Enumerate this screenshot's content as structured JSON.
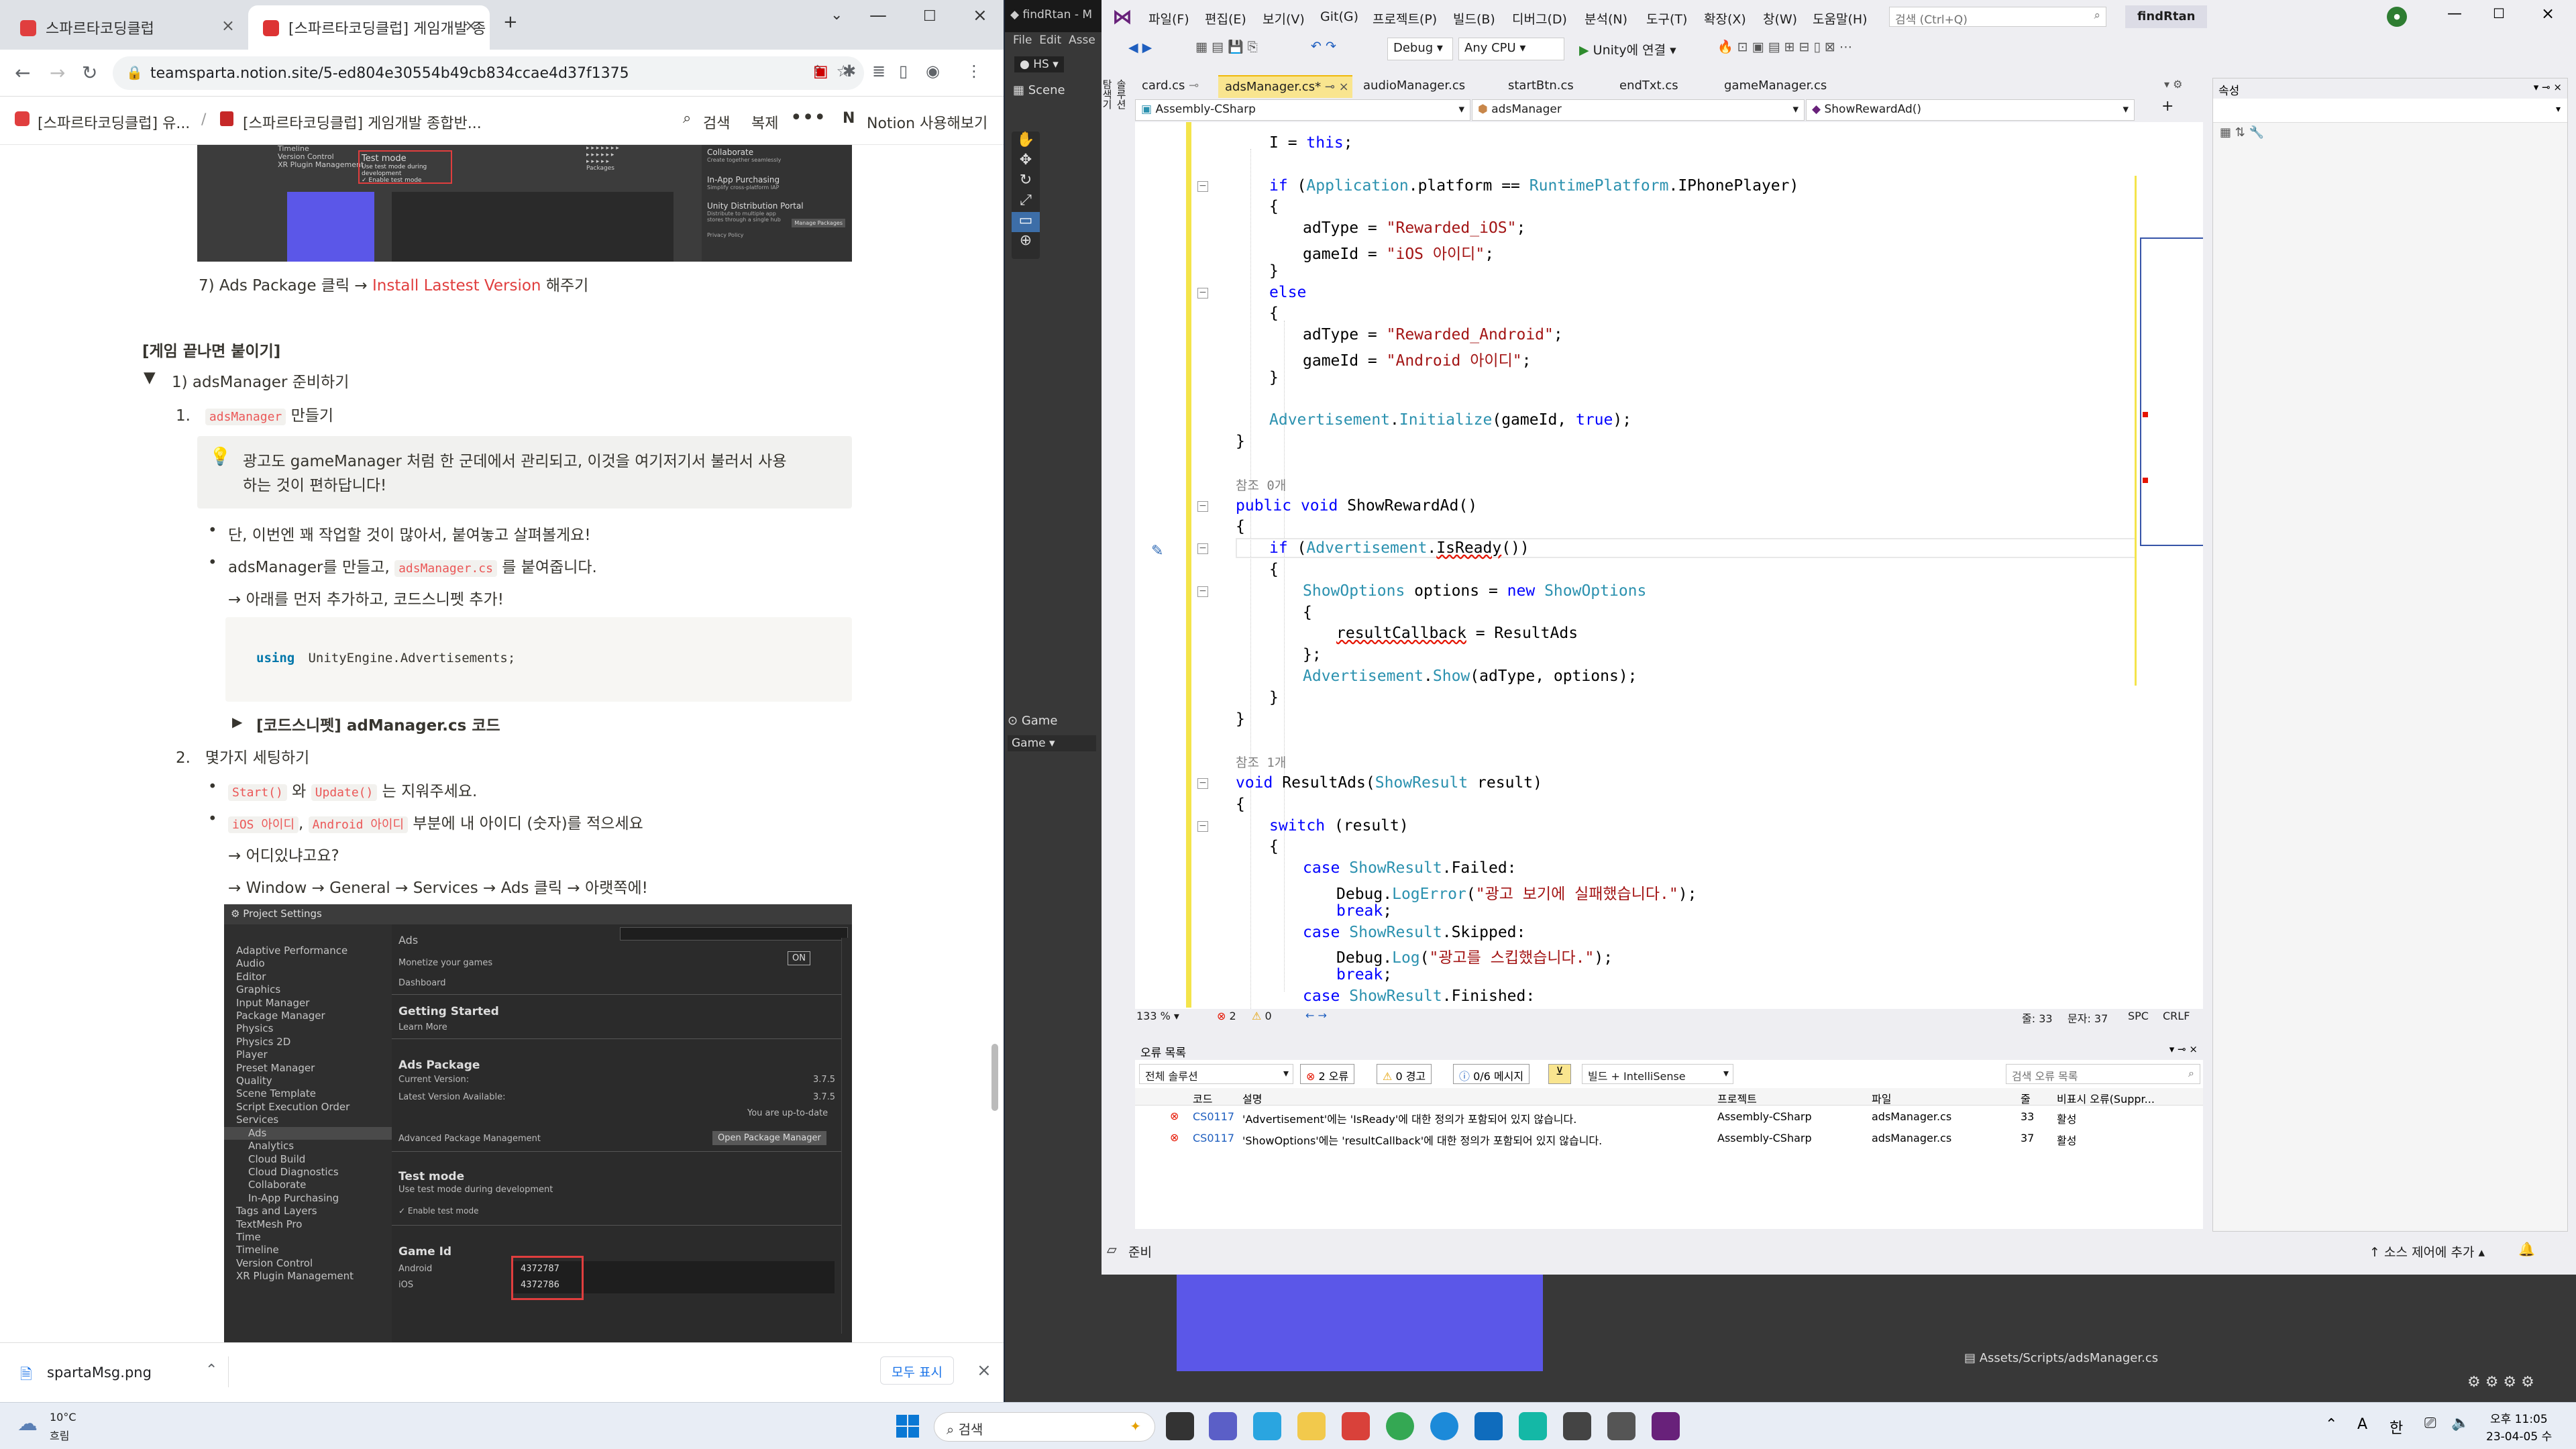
{
  "chrome": {
    "tabs": [
      {
        "title": "스파르타코딩클럽"
      },
      {
        "title": "[스파르타코딩클럽] 게임개발 종"
      }
    ],
    "url": "teamsparta.notion.site/5-ed804e30554b49cb834ccae4d37f1375",
    "breadcrumb1": "[스파르타코딩클럽] 유...",
    "breadcrumb2": "[스파르타코딩클럽] 게임개발 종합반...",
    "search_label": "검색",
    "duplicate_label": "복제",
    "use_notion_label": "Notion 사용해보기"
  },
  "notion": {
    "step7": [
      "7) Ads Package 클릭 → ",
      "Install Lastest Version",
      " 해주기"
    ],
    "section_heading": "[게임 끝나면 붙이기]",
    "toggle1": "1) adsManager 준비하기",
    "item1_code": "adsManager",
    "item1_text": " 만들기",
    "callout": [
      "광고도 gameManager 처럼 한 군데에서 관리되고, 이것을 여기저기서 불러서 사용",
      "하는 것이 편하답니다!"
    ],
    "bullet1": "단, 이번엔 꽤 작업할 것이 많아서, 붙여놓고 살펴볼게요!",
    "bullet2_a": "adsManager를 만들고, ",
    "bullet2_code": "adsManager.cs",
    "bullet2_b": " 를 붙여줍니다.",
    "bullet2_sub": "→ 아래를 먼저 추가하고, 코드스니펫 추가!",
    "code_using": "using",
    "code_ns": " UnityEngine.Advertisements;",
    "toggle2": "[코드스니펫] adManager.cs 코드",
    "item2": "몇가지 세팅하기",
    "b3_code1": "Start()",
    "b3_mid": " 와 ",
    "b3_code2": "Update()",
    "b3_end": " 는 지워주세요.",
    "b4_code1": "iOS 아이디",
    "b4_sep": ", ",
    "b4_code2": "Android 아이디",
    "b4_end": " 부분에 내 아이디 (숫자)를 적으세요",
    "b4_sub1": "→ 어디있냐고요?",
    "b4_sub2": "→ Window → General → Services → Ads 클릭 → 아랫쪽에!"
  },
  "top_screenshot": {
    "labels": [
      "Timeline",
      "Version Control",
      "XR Plugin Management"
    ],
    "test_mode": "Test mode",
    "test_mode_sub": "Use test mode during development",
    "enable": "✓ Enable test mode",
    "collab": "Collaborate",
    "collab_sub": "Create together seamlessly",
    "iap": "In-App Purchasing",
    "iap_sub": "Simplify cross-platform IAP",
    "udp": "Unity Distribution Portal",
    "udp_sub": "Distribute to multiple app stores through a single hub",
    "privacy": "Privacy Policy",
    "packages": "Packages",
    "manage": "Manage Packages"
  },
  "settings_screenshot": {
    "title": "Project Settings",
    "sidebar": [
      "Adaptive Performance",
      "Audio",
      "Editor",
      "Graphics",
      "Input Manager",
      "Package Manager",
      "Physics",
      "Physics 2D",
      "Player",
      "Preset Manager",
      "Quality",
      "Scene Template",
      "Script Execution Order",
      "Services",
      "Ads",
      "Analytics",
      "Cloud Build",
      "Cloud Diagnostics",
      "Collaborate",
      "In-App Purchasing",
      "Tags and Layers",
      "TextMesh Pro",
      "Time",
      "Timeline",
      "Version Control",
      "XR Plugin Management"
    ],
    "ads_header": "Ads",
    "monetize": "Monetize your games",
    "dashboard": "Dashboard",
    "on": "ON",
    "getting_started": "Getting Started",
    "learn_more": "Learn More",
    "ads_package": "Ads Package",
    "current_version_label": "Current Version:",
    "current_version": "3.7.5",
    "latest_label": "Latest Version Available:",
    "latest": "3.7.5",
    "up_to_date": "You are up-to-date",
    "advanced": "Advanced Package Management",
    "open_pm": "Open Package Manager",
    "test_mode": "Test mode",
    "test_mode_sub": "Use test mode during development",
    "enable": "✓ Enable test mode",
    "game_id": "Game Id",
    "android_label": "Android",
    "android_id": "4372787",
    "ios_label": "iOS",
    "ios_id": "4372786"
  },
  "downloads": {
    "file": "spartaMsg.png",
    "show_all": "모두 표시"
  },
  "unity": {
    "title": "findRtan - M",
    "menu": [
      "File",
      "Edit",
      "Asse"
    ],
    "account": "HS",
    "scene": "Scene",
    "game_tab": "Game",
    "game_dd": "Game",
    "asset_path": "Assets/Scripts/adsManager.cs"
  },
  "vs": {
    "menu": [
      "파일(F)",
      "편집(E)",
      "보기(V)",
      "Git(G)",
      "프로젝트(P)",
      "빌드(B)",
      "디버그(D)",
      "분석(N)",
      "도구(T)",
      "확장(X)",
      "창(W)",
      "도움말(H)"
    ],
    "search_placeholder": "검색 (Ctrl+Q)",
    "solution_name": "findRtan",
    "config": "Debug",
    "platform": "Any CPU",
    "run_label": "Unity에 연결",
    "doc_tabs": [
      "card.cs",
      "adsManager.cs*",
      "audioManager.cs",
      "startBtn.cs",
      "endTxt.cs",
      "gameManager.cs"
    ],
    "nav_project": "Assembly-CSharp",
    "nav_class": "adsManager",
    "nav_member": "ShowRewardAd()",
    "side_label": "솔루션 탐색기",
    "zoom": "133 %",
    "errors_count": "2",
    "warnings_count": "0",
    "cursor_line": "줄: 33",
    "cursor_col": "문자: 37",
    "spc": "SPC",
    "crlf": "CRLF",
    "properties_title": "속성",
    "status": "준비",
    "source_control": "소스 제어에 추가"
  },
  "code_lines": [
    {
      "indent": 1,
      "tokens": [
        [
          "",
          "I = "
        ],
        [
          "kw",
          "this"
        ],
        [
          "",
          ";"
        ]
      ]
    },
    {
      "indent": 0,
      "tokens": []
    },
    {
      "indent": 1,
      "tokens": [
        [
          "kw",
          "if"
        ],
        [
          "",
          " ("
        ],
        [
          "ty",
          "Application"
        ],
        [
          "",
          ".platform == "
        ],
        [
          "ty",
          "RuntimePlatform"
        ],
        [
          "",
          ".IPhonePlayer)"
        ]
      ],
      "fold": true
    },
    {
      "indent": 1,
      "tokens": [
        [
          "",
          "{"
        ]
      ]
    },
    {
      "indent": 2,
      "tokens": [
        [
          "",
          "adType = "
        ],
        [
          "st",
          "\"Rewarded_iOS\""
        ],
        [
          "",
          ";"
        ]
      ]
    },
    {
      "indent": 2,
      "tokens": [
        [
          "",
          "gameId = "
        ],
        [
          "st",
          "\"iOS 아이디\""
        ],
        [
          "",
          ";"
        ]
      ]
    },
    {
      "indent": 1,
      "tokens": [
        [
          "",
          "}"
        ]
      ]
    },
    {
      "indent": 1,
      "tokens": [
        [
          "kw",
          "else"
        ]
      ],
      "fold": true
    },
    {
      "indent": 1,
      "tokens": [
        [
          "",
          "{"
        ]
      ]
    },
    {
      "indent": 2,
      "tokens": [
        [
          "",
          "adType = "
        ],
        [
          "st",
          "\"Rewarded_Android\""
        ],
        [
          "",
          ";"
        ]
      ]
    },
    {
      "indent": 2,
      "tokens": [
        [
          "",
          "gameId = "
        ],
        [
          "st",
          "\"Android 아이디\""
        ],
        [
          "",
          ";"
        ]
      ]
    },
    {
      "indent": 1,
      "tokens": [
        [
          "",
          "}"
        ]
      ]
    },
    {
      "indent": 0,
      "tokens": []
    },
    {
      "indent": 1,
      "tokens": [
        [
          "ty",
          "Advertisement"
        ],
        [
          "",
          "."
        ],
        [
          "ty",
          "Initialize"
        ],
        [
          "",
          "(gameId, "
        ],
        [
          "kw",
          "true"
        ],
        [
          "",
          ");"
        ]
      ]
    },
    {
      "indent": 0,
      "tokens": [
        [
          "",
          "}"
        ]
      ]
    },
    {
      "indent": 0,
      "tokens": []
    },
    {
      "indent": 0,
      "tokens": [
        [
          "cm",
          "참조 0개"
        ]
      ]
    },
    {
      "indent": 0,
      "tokens": [
        [
          "kw",
          "public"
        ],
        [
          "",
          " "
        ],
        [
          "kw",
          "void"
        ],
        [
          "",
          " ShowRewardAd()"
        ]
      ],
      "fold": true
    },
    {
      "indent": 0,
      "tokens": [
        [
          "",
          "{"
        ]
      ]
    },
    {
      "indent": 1,
      "tokens": [
        [
          "kw",
          "if"
        ],
        [
          "",
          " ("
        ],
        [
          "ty",
          "Advertisement"
        ],
        [
          "",
          "."
        ],
        [
          "err",
          "IsReady"
        ],
        [
          "",
          "())"
        ]
      ],
      "fold": true,
      "current": true
    },
    {
      "indent": 1,
      "tokens": [
        [
          "",
          "{"
        ]
      ]
    },
    {
      "indent": 2,
      "tokens": [
        [
          "ty",
          "ShowOptions"
        ],
        [
          "",
          " options = "
        ],
        [
          "kw",
          "new"
        ],
        [
          "",
          " "
        ],
        [
          "ty",
          "ShowOptions"
        ]
      ],
      "fold": true
    },
    {
      "indent": 2,
      "tokens": [
        [
          "",
          "{"
        ]
      ]
    },
    {
      "indent": 3,
      "tokens": [
        [
          "err",
          "resultCallback"
        ],
        [
          "",
          " = ResultAds"
        ]
      ]
    },
    {
      "indent": 2,
      "tokens": [
        [
          "",
          "};"
        ]
      ]
    },
    {
      "indent": 2,
      "tokens": [
        [
          "ty",
          "Advertisement"
        ],
        [
          "",
          "."
        ],
        [
          "ty",
          "Show"
        ],
        [
          "",
          "(adType, options);"
        ]
      ]
    },
    {
      "indent": 1,
      "tokens": [
        [
          "",
          "}"
        ]
      ]
    },
    {
      "indent": 0,
      "tokens": [
        [
          "",
          "}"
        ]
      ]
    },
    {
      "indent": 0,
      "tokens": []
    },
    {
      "indent": 0,
      "tokens": [
        [
          "cm",
          "참조 1개"
        ]
      ]
    },
    {
      "indent": 0,
      "tokens": [
        [
          "kw",
          "void"
        ],
        [
          "",
          " ResultAds("
        ],
        [
          "ty",
          "ShowResult"
        ],
        [
          "",
          " result)"
        ]
      ],
      "fold": true
    },
    {
      "indent": 0,
      "tokens": [
        [
          "",
          "{"
        ]
      ]
    },
    {
      "indent": 1,
      "tokens": [
        [
          "kw",
          "switch"
        ],
        [
          "",
          " (result)"
        ]
      ],
      "fold": true
    },
    {
      "indent": 1,
      "tokens": [
        [
          "",
          "{"
        ]
      ]
    },
    {
      "indent": 2,
      "tokens": [
        [
          "kw",
          "case"
        ],
        [
          "",
          " "
        ],
        [
          "ty",
          "ShowResult"
        ],
        [
          "",
          ".Failed:"
        ]
      ]
    },
    {
      "indent": 3,
      "tokens": [
        [
          "",
          "Debug."
        ],
        [
          "ty",
          "LogError"
        ],
        [
          "",
          "("
        ],
        [
          "st",
          "\"광고 보기에 실패했습니다.\""
        ],
        [
          "",
          ");"
        ]
      ]
    },
    {
      "indent": 3,
      "tokens": [
        [
          "kw",
          "break"
        ],
        [
          "",
          ";"
        ]
      ]
    },
    {
      "indent": 2,
      "tokens": [
        [
          "kw",
          "case"
        ],
        [
          "",
          " "
        ],
        [
          "ty",
          "ShowResult"
        ],
        [
          "",
          ".Skipped:"
        ]
      ]
    },
    {
      "indent": 3,
      "tokens": [
        [
          "",
          "Debug."
        ],
        [
          "ty",
          "Log"
        ],
        [
          "",
          "("
        ],
        [
          "st",
          "\"광고를 스킵했습니다.\""
        ],
        [
          "",
          ");"
        ]
      ]
    },
    {
      "indent": 3,
      "tokens": [
        [
          "kw",
          "break"
        ],
        [
          "",
          ";"
        ]
      ]
    },
    {
      "indent": 2,
      "tokens": [
        [
          "kw",
          "case"
        ],
        [
          "",
          " "
        ],
        [
          "ty",
          "ShowResult"
        ],
        [
          "",
          ".Finished:"
        ]
      ]
    }
  ],
  "error_list": {
    "title": "오류 목록",
    "scope": "전체 솔루션",
    "errors_btn": "2 오류",
    "warnings_btn": "0 경고",
    "messages_btn": "0/6 메시지",
    "build_filter": "빌드 + IntelliSense",
    "search_placeholder": "검색 오류 목록",
    "columns": [
      "코드",
      "설명",
      "프로젝트",
      "파일",
      "줄",
      "비표시 오류(Suppr..."
    ],
    "rows": [
      {
        "code": "CS0117",
        "desc": "'Advertisement'에는 'IsReady'에 대한 정의가 포함되어 있지 않습니다.",
        "project": "Assembly-CSharp",
        "file": "adsManager.cs",
        "line": "33",
        "state": "활성"
      },
      {
        "code": "CS0117",
        "desc": "'ShowOptions'에는 'resultCallback'에 대한 정의가 포함되어 있지 않습니다.",
        "project": "Assembly-CSharp",
        "file": "adsManager.cs",
        "line": "37",
        "state": "활성"
      }
    ]
  },
  "taskbar": {
    "weather_temp": "10°C",
    "weather_desc": "흐림",
    "search_label": "검색",
    "ime_a": "A",
    "ime_han": "한",
    "time": "오후 11:05",
    "date": "23-04-05 수"
  },
  "colors": {
    "vs_accent": "#68217a",
    "error_red": "#e51400",
    "notion_red": "#e03e3e",
    "game_blue": "#5b57e8"
  }
}
